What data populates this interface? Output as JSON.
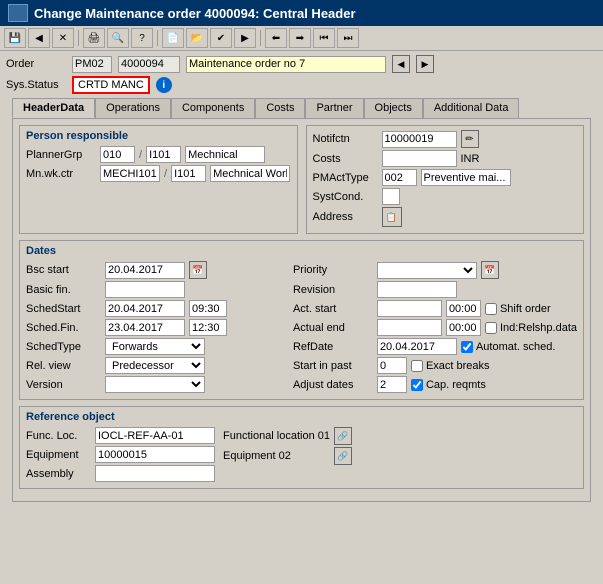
{
  "title": "Change Maintenance order 4000094: Central Header",
  "toolbar": {
    "buttons": [
      "⬛",
      "🔖",
      "⚙",
      "📋",
      "🔧",
      "📌",
      "📁",
      "🖨",
      "📝",
      "🔍",
      "💾"
    ]
  },
  "order": {
    "label": "Order",
    "type_value": "PM02",
    "number_value": "4000094",
    "description": "Maintenance order no 7"
  },
  "sys_status": {
    "label": "Sys.Status",
    "value": "CRTD MANC"
  },
  "tabs": [
    {
      "id": "headerdata",
      "label": "HeaderData",
      "active": true
    },
    {
      "id": "operations",
      "label": "Operations",
      "active": false
    },
    {
      "id": "components",
      "label": "Components",
      "active": false
    },
    {
      "id": "costs",
      "label": "Costs",
      "active": false
    },
    {
      "id": "partner",
      "label": "Partner",
      "active": false
    },
    {
      "id": "objects",
      "label": "Objects",
      "active": false
    },
    {
      "id": "additional",
      "label": "Additional Data",
      "active": false
    }
  ],
  "person_responsible": {
    "title": "Person responsible",
    "planner_grp_label": "PlannerGrp",
    "planner_grp_code": "010",
    "planner_grp_plant": "I101",
    "planner_grp_name": "Mechnical",
    "mn_wk_ctr_label": "Mn.wk.ctr",
    "mn_wk_ctr_code": "MECHI101",
    "mn_wk_ctr_plant": "I101",
    "mn_wk_ctr_name": "Mechnical Work c..."
  },
  "notif_section": {
    "notifctn_label": "Notifctn",
    "notifctn_value": "10000019",
    "costs_label": "Costs",
    "costs_value": "",
    "costs_unit": "INR",
    "pmact_label": "PMActType",
    "pmact_code": "002",
    "pmact_name": "Preventive mai...",
    "syscond_label": "SystCond.",
    "address_label": "Address"
  },
  "dates": {
    "title": "Dates",
    "bsc_start_label": "Bsc start",
    "bsc_start_value": "20.04.2017",
    "basic_fin_label": "Basic fin.",
    "basic_fin_value": "",
    "sched_start_label": "SchedStart",
    "sched_start_value": "20.04.2017",
    "sched_start_time": "09:30",
    "sched_fin_label": "Sched.Fin.",
    "sched_fin_value": "23.04.2017",
    "sched_fin_time": "12:30",
    "sched_type_label": "SchedType",
    "sched_type_value": "Forwards",
    "rel_view_label": "Rel. view",
    "rel_view_value": "Predecessor",
    "version_label": "Version",
    "version_value": "",
    "priority_label": "Priority",
    "priority_value": "",
    "revision_label": "Revision",
    "revision_value": "",
    "act_start_label": "Act. start",
    "act_start_value": "",
    "act_start_time": "00:00",
    "actual_end_label": "Actual end",
    "actual_end_value": "",
    "actual_end_time": "00:00",
    "ref_date_label": "RefDate",
    "ref_date_value": "20.04.2017",
    "start_in_past_label": "Start in past",
    "start_in_past_value": "0",
    "adjust_dates_label": "Adjust dates",
    "adjust_dates_value": "2",
    "checkboxes": {
      "shift_order": "Shift order",
      "ind_relshp": "Ind:Relshp.data",
      "automat_sched": "Automat. sched.",
      "exact_breaks": "Exact breaks",
      "cap_reqmts": "Cap. reqmts"
    },
    "automat_checked": true,
    "cap_reqmts_checked": true
  },
  "reference_object": {
    "title": "Reference object",
    "func_loc_label": "Func. Loc.",
    "func_loc_value": "IOCL-REF-AA-01",
    "func_loc_desc": "Functional location 01",
    "equipment_label": "Equipment",
    "equipment_value": "10000015",
    "equipment_desc": "Equipment 02",
    "assembly_label": "Assembly",
    "assembly_value": ""
  }
}
